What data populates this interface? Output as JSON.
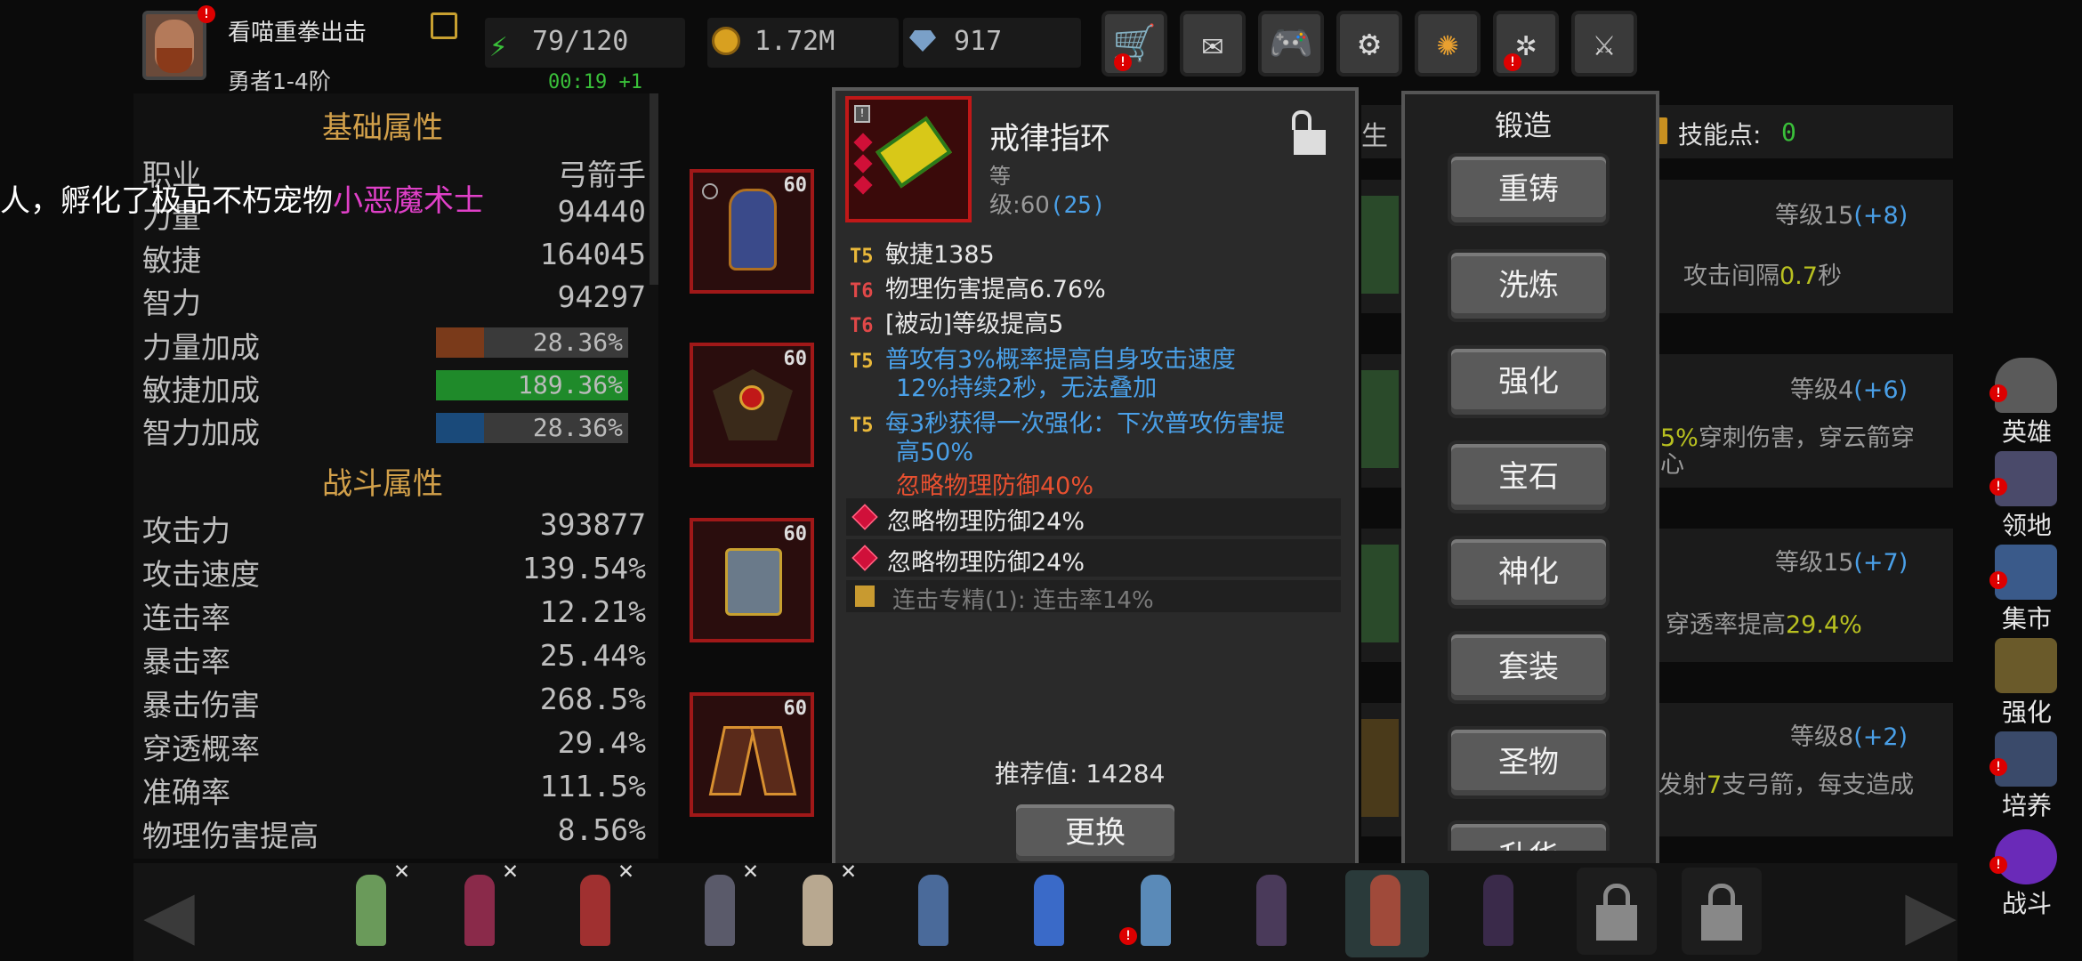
{
  "player": {
    "name": "看喵重拳出击",
    "rank": "勇者1-4阶",
    "timer": "00:19 +1"
  },
  "resources": {
    "energy": "79/120",
    "gold": "1.72M",
    "gems": "917"
  },
  "top_icons": [
    "cart-icon",
    "mail-icon",
    "gamepad-icon",
    "gear-icon",
    "aperture-icon",
    "fireworks-icon",
    "sword-off-icon"
  ],
  "broadcast": {
    "prefix": "人，孵化了极品不朽宠物",
    "highlight": "小恶魔术士",
    "highlight_color": "#e040c8"
  },
  "base_attrs": {
    "title": "基础属性",
    "rows": [
      {
        "k": "职业",
        "v": "弓箭手"
      },
      {
        "k": "力量",
        "v": "94440"
      },
      {
        "k": "敏捷",
        "v": "164045"
      },
      {
        "k": "智力",
        "v": "94297"
      }
    ],
    "bonuses": [
      {
        "k": "力量加成",
        "v": "28.36%",
        "fill": 0.25,
        "color": "#7a3a1a"
      },
      {
        "k": "敏捷加成",
        "v": "189.36%",
        "fill": 1.0,
        "color": "#1f8a2a"
      },
      {
        "k": "智力加成",
        "v": "28.36%",
        "fill": 0.25,
        "color": "#1a4a7a"
      }
    ]
  },
  "combat_attrs": {
    "title": "战斗属性",
    "rows": [
      {
        "k": "攻击力",
        "v": "393877"
      },
      {
        "k": "攻击速度",
        "v": "139.54%"
      },
      {
        "k": "连击率",
        "v": "12.21%"
      },
      {
        "k": "暴击率",
        "v": "25.44%"
      },
      {
        "k": "暴击伤害",
        "v": "268.5%"
      },
      {
        "k": "穿透概率",
        "v": "29.4%"
      },
      {
        "k": "准确率",
        "v": "111.5%"
      },
      {
        "k": "物理伤害提高",
        "v": "8.56%"
      }
    ]
  },
  "slots": [
    "60",
    "60",
    "60",
    "60"
  ],
  "item": {
    "name": "戒律指环",
    "grade_label": "等",
    "level_label": "级:60",
    "level_bonus": "(25)",
    "stats": [
      {
        "tier": "T5",
        "text": "敏捷1385",
        "color": "#e8e8e8",
        "tier_class": "t5"
      },
      {
        "tier": "T6",
        "text": "物理伤害提高6.76%",
        "color": "#e8e8e8",
        "tier_class": "t6"
      },
      {
        "tier": "T6",
        "text": "[被动]等级提高5",
        "color": "#e8e8e8",
        "tier_class": "t6"
      },
      {
        "tier": "T5",
        "text": "普攻有3%概率提高自身攻击速度",
        "text2": "12%持续2秒，无法叠加",
        "color": "#4aa0e8",
        "tier_class": "t5"
      },
      {
        "tier": "T5",
        "text": "每3秒获得一次强化：下次普攻伤害提",
        "text2": "高50%",
        "color": "#4aa0e8",
        "tier_class": "t5"
      }
    ],
    "special": "忽略物理防御40%",
    "gem_lines": [
      "忽略物理防御24%",
      "忽略物理防御24%"
    ],
    "set_line": "连击专精(1): 连击率14%",
    "recommend": "推荐值: 14284",
    "replace": "更换"
  },
  "forge": {
    "title": "锻造",
    "buttons": [
      "重铸",
      "洗炼",
      "强化",
      "宝石",
      "神化",
      "套装",
      "圣物",
      "升华"
    ]
  },
  "skill_header": {
    "tab": "生",
    "points_label": "技能点:",
    "points": "0"
  },
  "skills": [
    {
      "level": "等级15",
      "bonus": "(+8)",
      "pre": "攻击间隔",
      "hl": "0.7",
      "post": "秒"
    },
    {
      "level": "等级4",
      "bonus": "(+6)",
      "pre": "5%",
      "hl": "",
      "post": "穿刺伤害，穿云箭穿",
      "line2": "心"
    },
    {
      "level": "等级15",
      "bonus": "(+7)",
      "pre": "穿透率提高",
      "hl": "29.4%",
      "post": ""
    },
    {
      "level": "等级8",
      "bonus": "(+2)",
      "pre": "发射",
      "hl": "7",
      "post": "支弓箭，每支造成"
    }
  ],
  "right_nav": [
    {
      "label": "英雄",
      "icon": "helmet-icon"
    },
    {
      "label": "领地",
      "icon": "castle-icon"
    },
    {
      "label": "集市",
      "icon": "shop-icon"
    },
    {
      "label": "强化",
      "icon": "crystal-icon"
    },
    {
      "label": "培养",
      "icon": "sword-bowl-icon"
    },
    {
      "label": "战斗",
      "icon": "portal-icon"
    }
  ],
  "heroes": [
    "#6a9a5a",
    "#8a2a4a",
    "#a03030",
    "#5a5a6a",
    "#b8a890",
    "#4a6a9a",
    "#3a6ac8",
    "#5a8ab8",
    "#4a3a5a",
    "#a04a3a",
    "#3a2a4a"
  ]
}
